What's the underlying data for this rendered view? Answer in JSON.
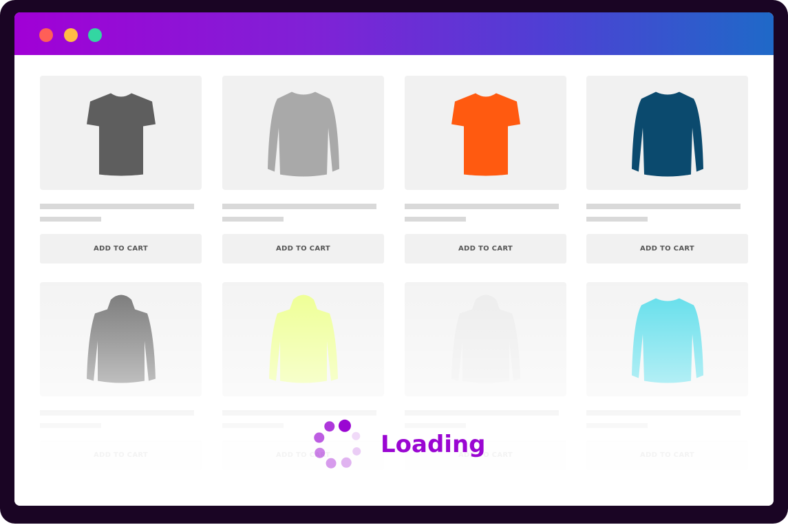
{
  "window": {
    "controls": [
      {
        "name": "close",
        "color": "#ff5f57"
      },
      {
        "name": "minimize",
        "color": "#ffbd44"
      },
      {
        "name": "maximize",
        "color": "#33d6a2"
      }
    ]
  },
  "products": [
    {
      "kind": "tshirt",
      "color": "#5e5e5e",
      "button": "ADD TO CART"
    },
    {
      "kind": "sweater",
      "color": "#a9a9a9",
      "button": "ADD TO CART"
    },
    {
      "kind": "tshirt",
      "color": "#ff5a10",
      "button": "ADD TO CART"
    },
    {
      "kind": "sweater",
      "color": "#0b4a6e",
      "button": "ADD TO CART"
    },
    {
      "kind": "hoodie",
      "color": "#5a5a5a",
      "button": "ADD TO CART"
    },
    {
      "kind": "hoodie",
      "color": "#eaff7a",
      "button": "ADD TO CART"
    },
    {
      "kind": "hoodie",
      "color": "#e8e8e8",
      "button": "ADD TO CART"
    },
    {
      "kind": "sweater",
      "color": "#3cd6e6",
      "button": "ADD TO CART"
    }
  ],
  "loader": {
    "text": "Loading",
    "color": "#9a06d2",
    "icon": "spinner-dots-icon"
  }
}
